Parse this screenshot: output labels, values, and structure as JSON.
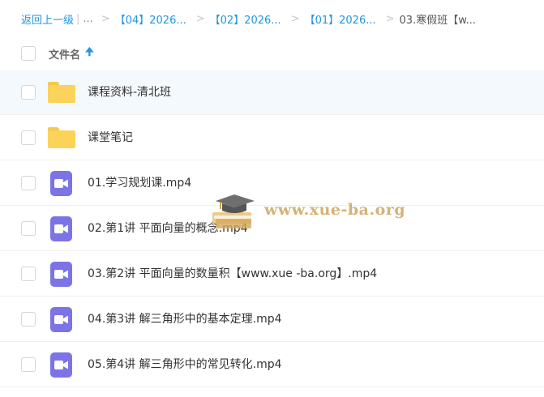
{
  "breadcrumb": {
    "back": "返回上一级",
    "divider": "|",
    "ellipsis": "...",
    "separator": ">",
    "crumbs": [
      "【04】2026...",
      "【02】2026...",
      "【01】2026..."
    ],
    "current": "03.寒假班【w..."
  },
  "list_header": {
    "column_name": "文件名",
    "sort_icon": "arrow-up-icon",
    "sort_direction": "ascending"
  },
  "files": [
    {
      "name": "课程资料-清北班",
      "type": "folder"
    },
    {
      "name": "课堂笔记",
      "type": "folder"
    },
    {
      "name": "01.学习规划课.mp4",
      "type": "video"
    },
    {
      "name": "02.第1讲 平面向量的概念.mp4",
      "type": "video"
    },
    {
      "name": "03.第2讲 平面向量的数量积【www.xue -ba.org】.mp4",
      "type": "video"
    },
    {
      "name": "04.第3讲 解三角形中的基本定理.mp4",
      "type": "video"
    },
    {
      "name": "05.第4讲 解三角形中的常见转化.mp4",
      "type": "video"
    }
  ],
  "watermark": {
    "text": "www.xue-ba.org",
    "icon": "graduation-cap-icon"
  },
  "colors": {
    "link": "#2196e0",
    "folder": "#fbd35a",
    "video": "#7c73e6",
    "hover_row": "#f4f9fd",
    "watermark": "#cda55f"
  }
}
